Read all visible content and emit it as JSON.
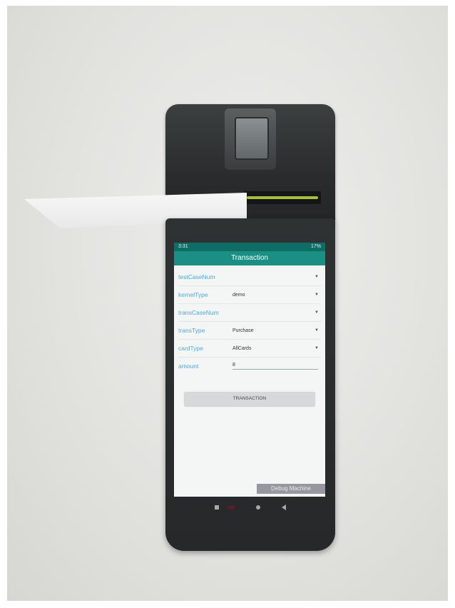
{
  "status_bar": {
    "time": "3:31",
    "battery": "17%"
  },
  "app_bar": {
    "title": "Transaction"
  },
  "form": {
    "rows": [
      {
        "label": "testCaseNum",
        "value": ""
      },
      {
        "label": "kernelType",
        "value": "demo"
      },
      {
        "label": "transCaseNum",
        "value": ""
      },
      {
        "label": "transType",
        "value": "Purchase"
      },
      {
        "label": "cardType",
        "value": "AllCards"
      }
    ],
    "amount": {
      "label": "amount",
      "value": "8"
    }
  },
  "transaction_button": {
    "label": "TRANSACTION"
  },
  "debug_banner": {
    "text": "Debug Machine"
  },
  "icons": [
    "fingerprint-sensor-icon",
    "recents-icon",
    "home-icon",
    "back-icon"
  ],
  "colors": {
    "app_bar": "#1c8f84",
    "status_bar": "#0e6e66",
    "label": "#4aa9d9",
    "device_body": "#2b2d2e"
  }
}
